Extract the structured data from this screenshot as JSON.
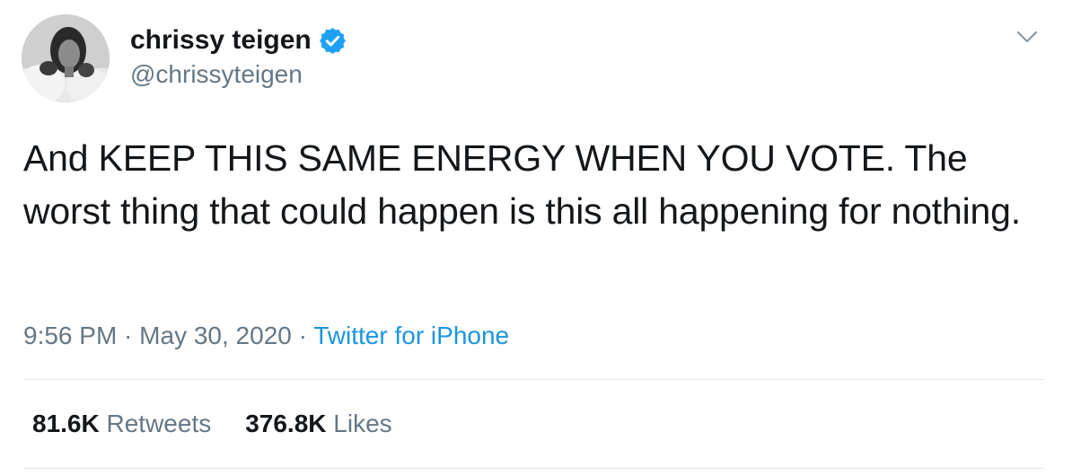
{
  "author": {
    "display_name": "chrissy teigen",
    "handle": "@chrissyteigen",
    "verified": true
  },
  "tweet": {
    "text": "And KEEP THIS SAME ENERGY WHEN YOU VOTE. The worst thing that could happen is this all happening for nothing."
  },
  "meta": {
    "time": "9:56 PM",
    "separator1": " · ",
    "date": "May 30, 2020",
    "separator2": " · ",
    "source": "Twitter for iPhone"
  },
  "stats": {
    "retweets_count": "81.6K",
    "retweets_label": "Retweets",
    "likes_count": "376.8K",
    "likes_label": "Likes"
  },
  "colors": {
    "text": "#14171a",
    "secondary": "#657786",
    "link": "#1b95e0",
    "verified": "#1da1f2",
    "divider": "#e1e8ed"
  },
  "icons": {
    "verified": "verified-badge-icon",
    "caret": "chevron-down-icon"
  }
}
